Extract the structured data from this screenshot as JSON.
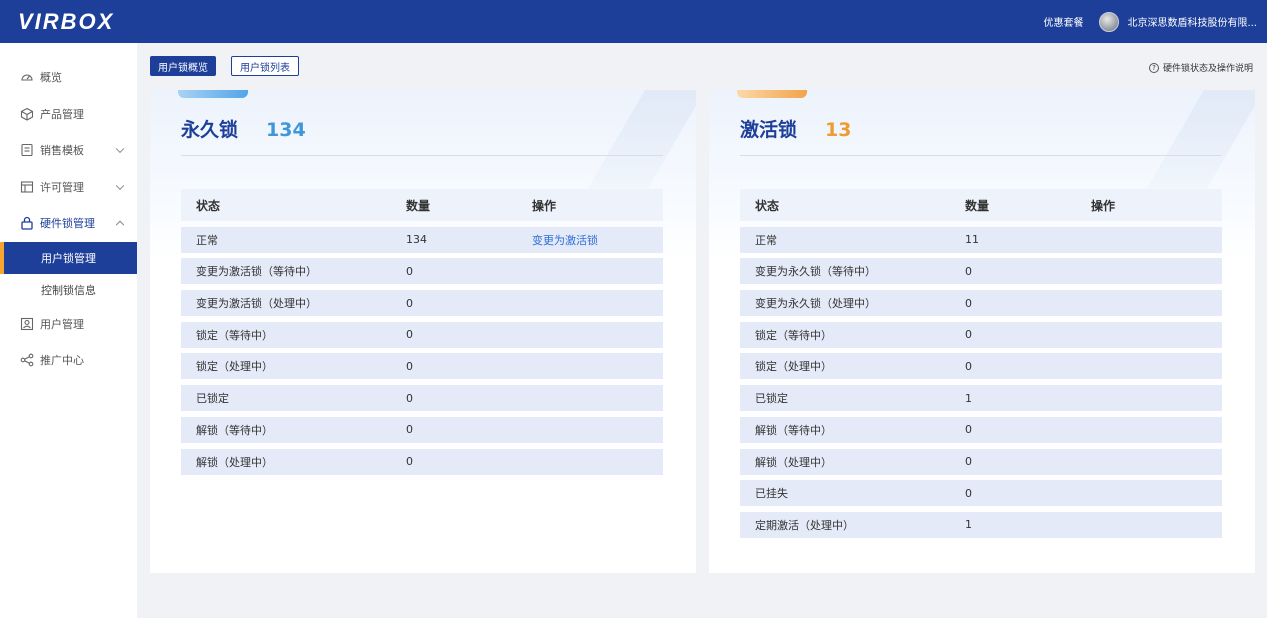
{
  "brand": {
    "logo": "VIRBOX"
  },
  "header": {
    "promo": "优惠套餐",
    "company": "北京深思数盾科技股份有限..."
  },
  "sidebar": {
    "items": [
      {
        "label": "概览",
        "icon": "dashboard-icon"
      },
      {
        "label": "产品管理",
        "icon": "cube-icon"
      },
      {
        "label": "销售模板",
        "icon": "template-icon"
      },
      {
        "label": "许可管理",
        "icon": "license-icon"
      },
      {
        "label": "硬件锁管理",
        "icon": "lock-icon"
      },
      {
        "label": "用户管理",
        "icon": "user-manage-icon"
      },
      {
        "label": "推广中心",
        "icon": "share-icon"
      }
    ],
    "sub_items": [
      {
        "label": "用户锁管理",
        "active": true
      },
      {
        "label": "控制锁信息",
        "active": false
      }
    ]
  },
  "toolbar": {
    "tab_overview": "用户锁概览",
    "tab_list": "用户锁列表",
    "help": "硬件锁状态及操作说明"
  },
  "colors": {
    "primary": "#1d3f9a",
    "accent_orange": "#f7a531",
    "count_blue": "#3f97d8",
    "count_orange": "#ef9b35",
    "link": "#2e6fd8"
  },
  "permanent": {
    "title": "永久锁",
    "count": "134",
    "headers": {
      "status": "状态",
      "qty": "数量",
      "op": "操作"
    },
    "rows": [
      {
        "status": "正常",
        "qty": "134",
        "op": "变更为激活锁"
      },
      {
        "status": "变更为激活锁（等待中）",
        "qty": "0",
        "op": ""
      },
      {
        "status": "变更为激活锁（处理中）",
        "qty": "0",
        "op": ""
      },
      {
        "status": "锁定（等待中）",
        "qty": "0",
        "op": ""
      },
      {
        "status": "锁定（处理中）",
        "qty": "0",
        "op": ""
      },
      {
        "status": "已锁定",
        "qty": "0",
        "op": ""
      },
      {
        "status": "解锁（等待中）",
        "qty": "0",
        "op": ""
      },
      {
        "status": "解锁（处理中）",
        "qty": "0",
        "op": ""
      }
    ]
  },
  "activation": {
    "title": "激活锁",
    "count": "13",
    "headers": {
      "status": "状态",
      "qty": "数量",
      "op": "操作"
    },
    "rows": [
      {
        "status": "正常",
        "qty": "11",
        "op": ""
      },
      {
        "status": "变更为永久锁（等待中）",
        "qty": "0",
        "op": ""
      },
      {
        "status": "变更为永久锁（处理中）",
        "qty": "0",
        "op": ""
      },
      {
        "status": "锁定（等待中）",
        "qty": "0",
        "op": ""
      },
      {
        "status": "锁定（处理中）",
        "qty": "0",
        "op": ""
      },
      {
        "status": "已锁定",
        "qty": "1",
        "op": ""
      },
      {
        "status": "解锁（等待中）",
        "qty": "0",
        "op": ""
      },
      {
        "status": "解锁（处理中）",
        "qty": "0",
        "op": ""
      },
      {
        "status": "已挂失",
        "qty": "0",
        "op": ""
      },
      {
        "status": "定期激活（处理中）",
        "qty": "1",
        "op": ""
      }
    ]
  }
}
